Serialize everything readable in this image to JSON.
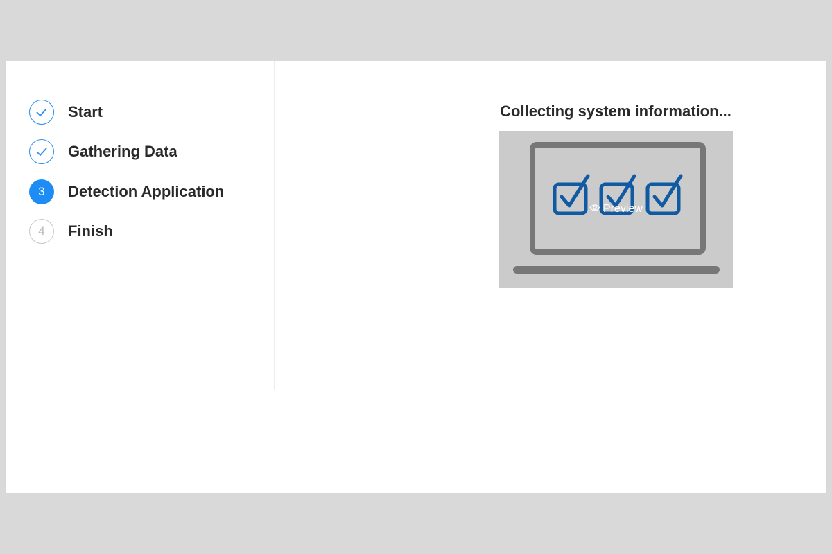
{
  "steps": [
    {
      "number": "1",
      "label": "Start",
      "status": "done"
    },
    {
      "number": "2",
      "label": "Gathering Data",
      "status": "done"
    },
    {
      "number": "3",
      "label": "Detection Application",
      "status": "active"
    },
    {
      "number": "4",
      "label": "Finish",
      "status": "pending"
    }
  ],
  "main": {
    "title": "Collecting system information...",
    "preview_label": "Preview"
  },
  "colors": {
    "accent": "#1e8cf5",
    "check_blue": "#0f5aa3",
    "laptop_gray": "#777777",
    "image_bg": "#cbcbcb"
  }
}
